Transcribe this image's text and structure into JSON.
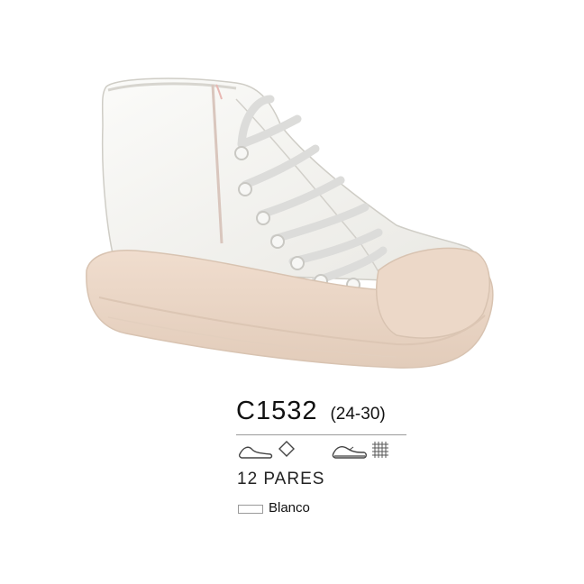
{
  "product": {
    "code": "C1532",
    "sizes": "(24-30)",
    "pairs": "12 PARES",
    "color_name": "Blanco",
    "shoe_colors": {
      "upper": "#f3f2ee",
      "sole": "#ead6c6",
      "laces": "#dcdcda"
    }
  },
  "icons": {
    "upper_material": "shoe-outline-icon",
    "material_symbol": "diamond-icon",
    "sole_type": "sneaker-sole-icon",
    "lining": "mesh-grid-icon"
  }
}
